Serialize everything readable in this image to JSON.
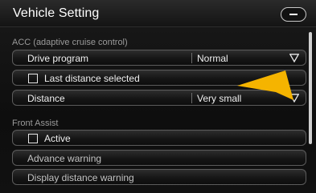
{
  "header": {
    "title": "Vehicle Setting",
    "minimize_icon": "minus-icon"
  },
  "acc": {
    "section_label": "ACC (adaptive cruise control)",
    "drive_program": {
      "label": "Drive program",
      "value": "Normal"
    },
    "last_distance": {
      "label": "Last distance selected",
      "checked": false
    },
    "distance": {
      "label": "Distance",
      "value": "Very small"
    }
  },
  "front_assist": {
    "section_label": "Front Assist",
    "active": {
      "label": "Active",
      "checked": false
    },
    "advance_warning": {
      "label": "Advance warning"
    },
    "display_distance_warning": {
      "label": "Display distance warning"
    }
  },
  "colors": {
    "pointer": "#f5b400",
    "row_border": "#5c5c5c",
    "section_text": "#9a9a9a"
  }
}
